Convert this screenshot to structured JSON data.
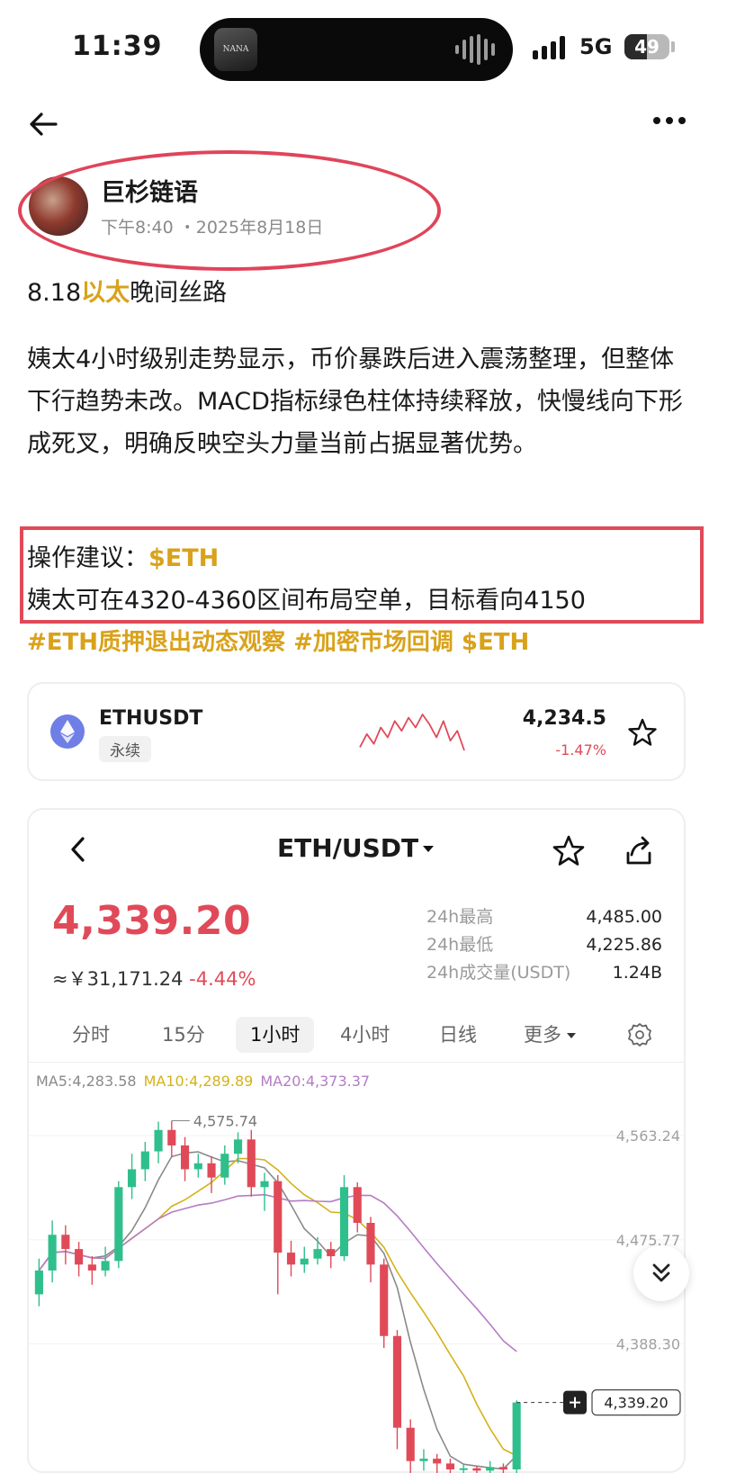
{
  "status_bar": {
    "time": "11:39",
    "network": "5G",
    "battery": "49",
    "battery_level": 0.49,
    "island_app_label": "NANA"
  },
  "nav": {
    "back_icon": "arrow-left-icon",
    "more_icon": "more-horizontal-icon"
  },
  "post": {
    "author": "巨杉链语",
    "time": "下午8:40",
    "separator": "・",
    "date": "2025年8月18日",
    "title_prefix": "8.18",
    "title_highlight": "以太",
    "title_suffix": "晚间丝路",
    "body": "姨太4小时级别走势显示，币价暴跌后进入震荡整理，但整体下行趋势未改。MACD指标绿色柱体持续释放，快慢线向下形成死叉，明确反映空头力量当前占据显著优势。",
    "advice_label": "操作建议：",
    "advice_tag": "$ETH",
    "advice_text": "姨太可在4320-4360区间布局空单，目标看向4150",
    "hashtags": "#ETH质押退出动态观察 #加密市场回调 $ETH"
  },
  "ticker": {
    "symbol": "ETHUSDT",
    "badge": "永续",
    "price": "4,234.5",
    "change": "-1.47%",
    "sparkline": [
      6,
      10,
      7,
      12,
      9,
      14,
      11,
      15,
      12,
      16,
      13,
      9,
      14,
      8,
      11,
      5
    ],
    "colors": {
      "down": "#e04a58"
    }
  },
  "trade": {
    "pair": "ETH/USDT",
    "price": "4,339.20",
    "cny": "≈￥31,171.24",
    "cny_change": "-4.44%",
    "stats": [
      {
        "label": "24h最高",
        "value": "4,485.00"
      },
      {
        "label": "24h最低",
        "value": "4,225.86"
      },
      {
        "label": "24h成交量(USDT)",
        "value": "1.24B"
      }
    ],
    "tabs": [
      {
        "label": "分时",
        "active": false
      },
      {
        "label": "15分",
        "active": false
      },
      {
        "label": "1小时",
        "active": true
      },
      {
        "label": "4小时",
        "active": false
      },
      {
        "label": "日线",
        "active": false
      },
      {
        "label": "更多",
        "active": false
      }
    ],
    "ma": {
      "ma5": "MA5:4,283.58",
      "ma10": "MA10:4,289.89",
      "ma20": "MA20:4,373.37"
    },
    "colors": {
      "up": "#2fbf8c",
      "down": "#e04a58",
      "ma5": "#8a8a8a",
      "ma10": "#d4b21a",
      "ma20": "#b57cc4"
    }
  },
  "chart_data": {
    "type": "candlestick",
    "interval": "1小时",
    "price_labels": [
      "4,563.24",
      "4,475.77",
      "4,388.30"
    ],
    "price_levels": [
      4563.24,
      4475.77,
      4388.3
    ],
    "high_marker": "4,575.74",
    "high_value": 4575.74,
    "last_price_label": "4,339.20",
    "last_price": 4339.2,
    "y_range": [
      4280,
      4595
    ],
    "candles": [
      {
        "o": 4430,
        "c": 4450,
        "h": 4460,
        "l": 4420
      },
      {
        "o": 4450,
        "c": 4480,
        "h": 4492,
        "l": 4440
      },
      {
        "o": 4480,
        "c": 4468,
        "h": 4488,
        "l": 4455
      },
      {
        "o": 4468,
        "c": 4455,
        "h": 4474,
        "l": 4445
      },
      {
        "o": 4455,
        "c": 4450,
        "h": 4462,
        "l": 4438
      },
      {
        "o": 4450,
        "c": 4458,
        "h": 4470,
        "l": 4445
      },
      {
        "o": 4458,
        "c": 4520,
        "h": 4525,
        "l": 4452
      },
      {
        "o": 4520,
        "c": 4535,
        "h": 4548,
        "l": 4510
      },
      {
        "o": 4535,
        "c": 4550,
        "h": 4558,
        "l": 4525
      },
      {
        "o": 4550,
        "c": 4568,
        "h": 4575,
        "l": 4540
      },
      {
        "o": 4568,
        "c": 4555,
        "h": 4575.74,
        "l": 4545
      },
      {
        "o": 4555,
        "c": 4535,
        "h": 4562,
        "l": 4525
      },
      {
        "o": 4535,
        "c": 4540,
        "h": 4548,
        "l": 4528
      },
      {
        "o": 4540,
        "c": 4528,
        "h": 4546,
        "l": 4515
      },
      {
        "o": 4528,
        "c": 4548,
        "h": 4555,
        "l": 4522
      },
      {
        "o": 4548,
        "c": 4560,
        "h": 4566,
        "l": 4540
      },
      {
        "o": 4560,
        "c": 4520,
        "h": 4568,
        "l": 4512
      },
      {
        "o": 4520,
        "c": 4525,
        "h": 4532,
        "l": 4500
      },
      {
        "o": 4525,
        "c": 4465,
        "h": 4530,
        "l": 4430
      },
      {
        "o": 4465,
        "c": 4455,
        "h": 4475,
        "l": 4445
      },
      {
        "o": 4455,
        "c": 4460,
        "h": 4470,
        "l": 4448
      },
      {
        "o": 4460,
        "c": 4468,
        "h": 4478,
        "l": 4455
      },
      {
        "o": 4468,
        "c": 4462,
        "h": 4474,
        "l": 4452
      },
      {
        "o": 4462,
        "c": 4520,
        "h": 4530,
        "l": 4458
      },
      {
        "o": 4520,
        "c": 4490,
        "h": 4524,
        "l": 4482
      },
      {
        "o": 4490,
        "c": 4455,
        "h": 4495,
        "l": 4440
      },
      {
        "o": 4455,
        "c": 4395,
        "h": 4460,
        "l": 4385
      },
      {
        "o": 4395,
        "c": 4318,
        "h": 4400,
        "l": 4300
      },
      {
        "o": 4318,
        "c": 4290,
        "h": 4325,
        "l": 4280
      },
      {
        "o": 4290,
        "c": 4292,
        "h": 4300,
        "l": 4282
      },
      {
        "o": 4292,
        "c": 4288,
        "h": 4296,
        "l": 4280
      },
      {
        "o": 4288,
        "c": 4283,
        "h": 4292,
        "l": 4280
      },
      {
        "o": 4283,
        "c": 4284,
        "h": 4288,
        "l": 4280
      },
      {
        "o": 4284,
        "c": 4282,
        "h": 4286,
        "l": 4280
      },
      {
        "o": 4282,
        "c": 4285,
        "h": 4290,
        "l": 4280
      },
      {
        "o": 4285,
        "c": 4283,
        "h": 4288,
        "l": 4280
      },
      {
        "o": 4283,
        "c": 4339.2,
        "h": 4341,
        "l": 4280
      }
    ]
  }
}
